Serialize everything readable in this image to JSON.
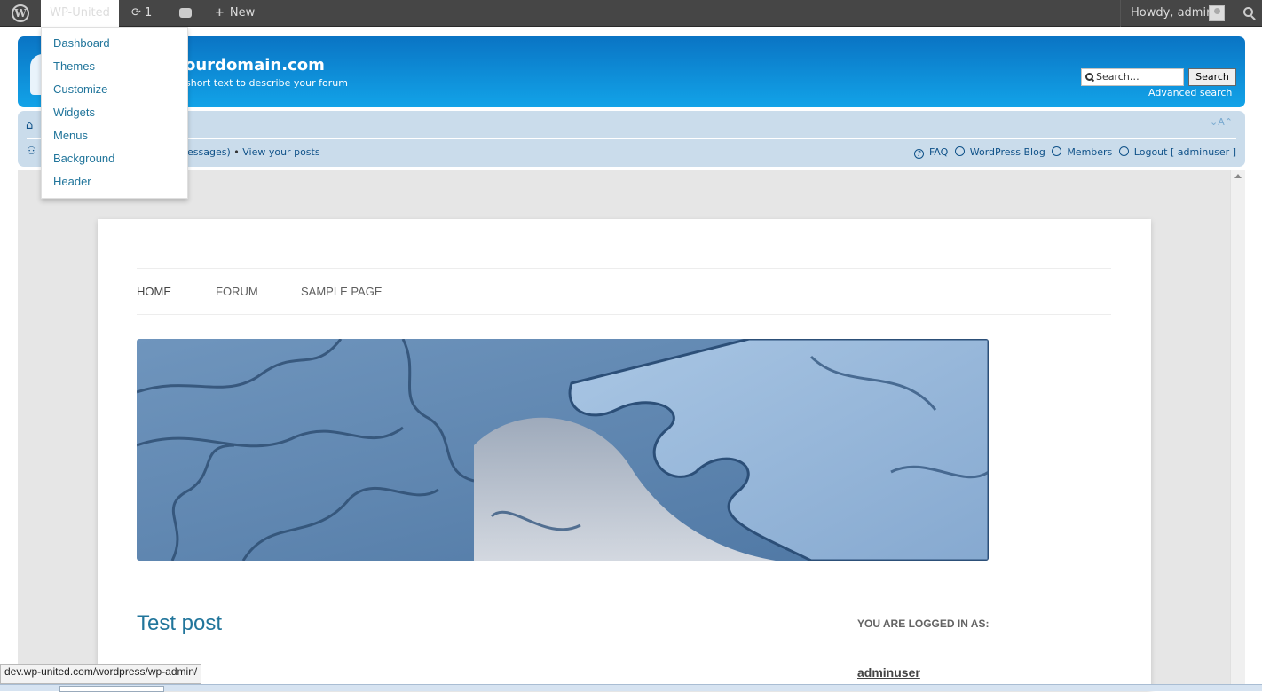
{
  "admin_bar": {
    "site_name": "WP-United",
    "updates_count": "1",
    "new_label": "New",
    "howdy": "Howdy, admin"
  },
  "site_menu": {
    "items": [
      "Dashboard",
      "Themes",
      "Customize",
      "Widgets",
      "Menus",
      "Background",
      "Header"
    ]
  },
  "forum_header": {
    "site_title": "ourdomain.com",
    "site_description": "short text to describe your forum",
    "search_placeholder": "Search…",
    "search_button": "Search",
    "advanced_search": "Advanced search"
  },
  "navbar": {
    "font_size_control": "⌄A⌃",
    "messages_fragment": "essages)",
    "view_posts": "View your posts",
    "links": {
      "faq": "FAQ",
      "blog": "WordPress Blog",
      "members": "Members",
      "logout": "Logout [ adminuser ]"
    }
  },
  "wp_page": {
    "nav": {
      "home": "HOME",
      "forum": "FORUM",
      "sample": "SAMPLE PAGE"
    },
    "post_title": "Test post",
    "sidebar_heading": "YOU ARE LOGGED IN AS:",
    "sidebar_user": "adminuser"
  },
  "status_bar": {
    "url": "dev.wp-united.com/wordpress/wp-admin/"
  },
  "colors": {
    "admin_bar": "#464646",
    "link": "#21759b",
    "forum_header": "#0a74c4",
    "navbar": "#cadceb"
  }
}
